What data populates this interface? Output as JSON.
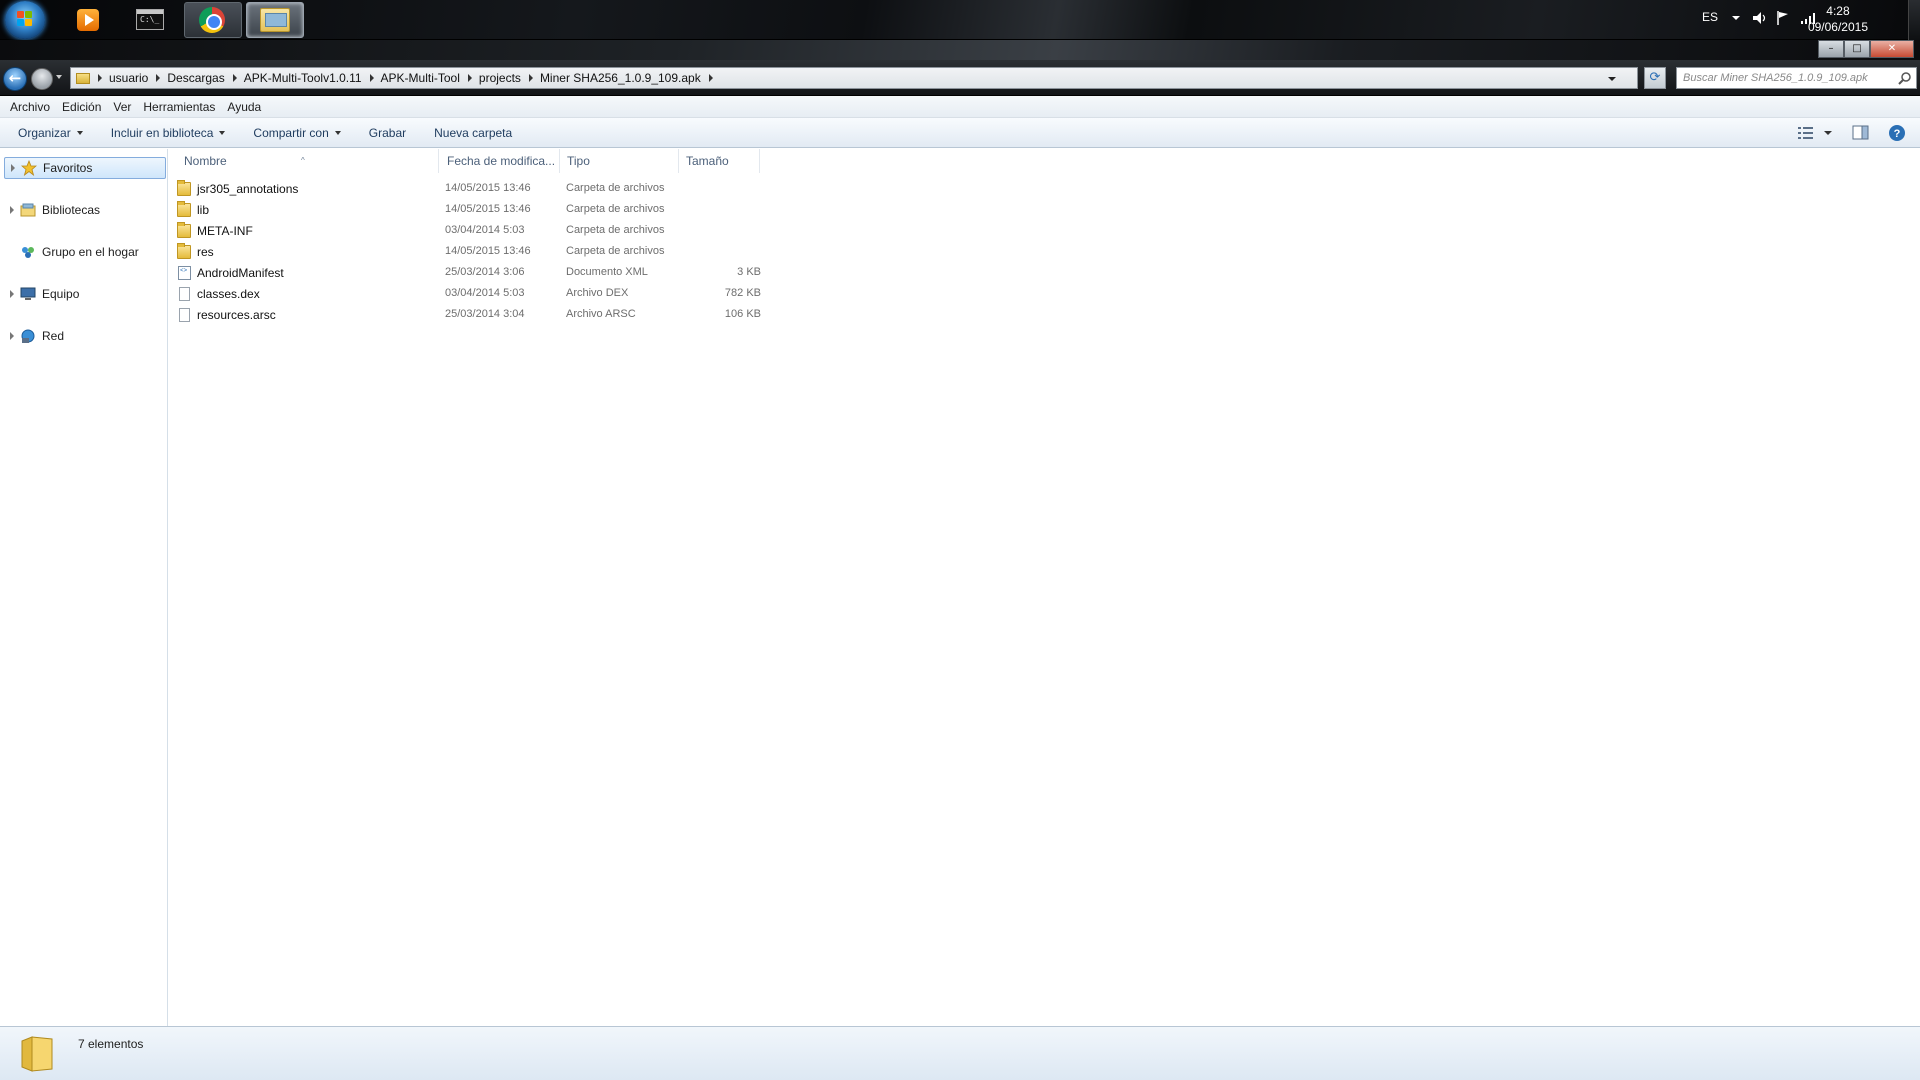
{
  "taskbar": {
    "apps": [
      {
        "name": "windows-media-player"
      },
      {
        "name": "command-prompt"
      },
      {
        "name": "google-chrome"
      },
      {
        "name": "windows-explorer"
      }
    ],
    "tray": {
      "language": "ES",
      "time": "4:28",
      "date": "09/06/2015"
    }
  },
  "window": {
    "controls": {
      "minimize": "–",
      "maximize": "□",
      "close": "✕"
    }
  },
  "navigation": {
    "breadcrumbs": [
      "usuario",
      "Descargas",
      "APK-Multi-Toolv1.0.11",
      "APK-Multi-Tool",
      "projects",
      "Miner SHA256_1.0.9_109.apk"
    ],
    "search_placeholder": "Buscar Miner SHA256_1.0.9_109.apk"
  },
  "menubar": [
    "Archivo",
    "Edición",
    "Ver",
    "Herramientas",
    "Ayuda"
  ],
  "toolbar": {
    "organize": "Organizar",
    "include_library": "Incluir en biblioteca",
    "share_with": "Compartir con",
    "burn": "Grabar",
    "new_folder": "Nueva carpeta"
  },
  "navpane": {
    "favorites": "Favoritos",
    "libraries": "Bibliotecas",
    "homegroup": "Grupo en el hogar",
    "computer": "Equipo",
    "network": "Red"
  },
  "columns": {
    "name": "Nombre",
    "date": "Fecha de modifica...",
    "type": "Tipo",
    "size": "Tamaño"
  },
  "files": [
    {
      "name": "jsr305_annotations",
      "date": "14/05/2015 13:46",
      "type": "Carpeta de archivos",
      "size": ""
    },
    {
      "name": "lib",
      "date": "14/05/2015 13:46",
      "type": "Carpeta de archivos",
      "size": ""
    },
    {
      "name": "META-INF",
      "date": "03/04/2014 5:03",
      "type": "Carpeta de archivos",
      "size": ""
    },
    {
      "name": "res",
      "date": "14/05/2015 13:46",
      "type": "Carpeta de archivos",
      "size": ""
    },
    {
      "name": "AndroidManifest",
      "date": "25/03/2014 3:06",
      "type": "Documento XML",
      "size": "3 KB"
    },
    {
      "name": "classes.dex",
      "date": "03/04/2014 5:03",
      "type": "Archivo DEX",
      "size": "782 KB"
    },
    {
      "name": "resources.arsc",
      "date": "25/03/2014 3:04",
      "type": "Archivo ARSC",
      "size": "106 KB"
    }
  ],
  "status": {
    "item_count": "7 elementos"
  }
}
